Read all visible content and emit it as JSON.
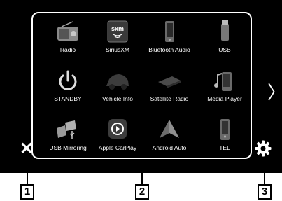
{
  "tiles": [
    {
      "label": "Radio",
      "icon": "radio-icon"
    },
    {
      "label": "SiriusXM",
      "icon": "siriusxm-icon",
      "badge": "sxm"
    },
    {
      "label": "Bluetooth Audio",
      "icon": "bluetooth-audio-icon"
    },
    {
      "label": "USB",
      "icon": "usb-icon"
    },
    {
      "label": "STANDBY",
      "icon": "standby-icon"
    },
    {
      "label": "Vehicle Info",
      "icon": "vehicle-icon"
    },
    {
      "label": "Satellite Radio",
      "icon": "satellite-icon"
    },
    {
      "label": "Media Player",
      "icon": "media-player-icon"
    },
    {
      "label": "USB Mirroring",
      "icon": "usb-mirroring-icon"
    },
    {
      "label": "Apple CarPlay",
      "icon": "apple-carplay-icon"
    },
    {
      "label": "Android Auto",
      "icon": "android-auto-icon"
    },
    {
      "label": "TEL",
      "icon": "tel-icon"
    }
  ],
  "controls": {
    "close": "✕",
    "next": "〉"
  },
  "callouts": [
    "1",
    "2",
    "3"
  ]
}
